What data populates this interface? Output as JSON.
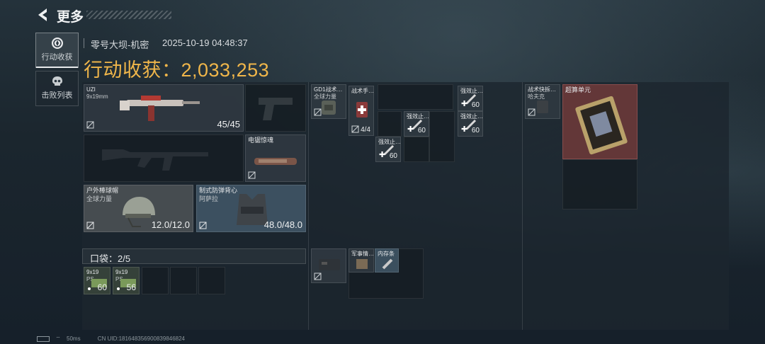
{
  "header": {
    "title": "更多"
  },
  "side_tabs": [
    {
      "label": "行动收获",
      "icon": "compass-icon",
      "active": true
    },
    {
      "label": "击败列表",
      "icon": "skull-icon",
      "active": false
    }
  ],
  "operation": {
    "map_name": "零号大坝-机密",
    "datetime": "2025-10-19 04:48:37",
    "haul_label": "行动收获：",
    "haul_value": "2,033,253"
  },
  "gear": {
    "primary_weapon": {
      "name": "UZI",
      "ammo_type": "9x19mm",
      "ammo": "45/45"
    },
    "melee": {
      "name": "电锯惊魂"
    },
    "helmet": {
      "name": "户外棒球帽",
      "brand": "全球力量",
      "durability": "12.0/12.0"
    },
    "armor": {
      "name": "制式防弹背心",
      "brand": "阿萨拉",
      "durability": "48.0/48.0"
    }
  },
  "pocket": {
    "label": "口袋：2/5",
    "items": [
      {
        "name": "9x19",
        "sub": "PS",
        "count": "60"
      },
      {
        "name": "9x19",
        "sub": "PS",
        "count": "56"
      }
    ]
  },
  "backpack_items": [
    {
      "name": "GD1战术…",
      "sub": "全球力量"
    },
    {
      "name": "战术手…",
      "count": "4/4"
    },
    {
      "name": "强效止…",
      "count": "60"
    },
    {
      "name": "强效止…",
      "count": "60"
    },
    {
      "name": "强效止…",
      "count": "60"
    },
    {
      "name": "强效止…",
      "count": "60"
    },
    {
      "name": "强效止…",
      "count": "60"
    }
  ],
  "bag_items": [
    {
      "name": "军事情…"
    },
    {
      "name": "内存条"
    }
  ],
  "safebox": [
    {
      "name": "战术快拆…",
      "sub": "哈夫克"
    },
    {
      "name": "超算单元"
    }
  ],
  "status": {
    "ping": "50ms",
    "uid": "CN UID:1816483569008398468​24"
  },
  "colors": {
    "haul": "#f0b64a",
    "rare_red": "#703a3a"
  }
}
